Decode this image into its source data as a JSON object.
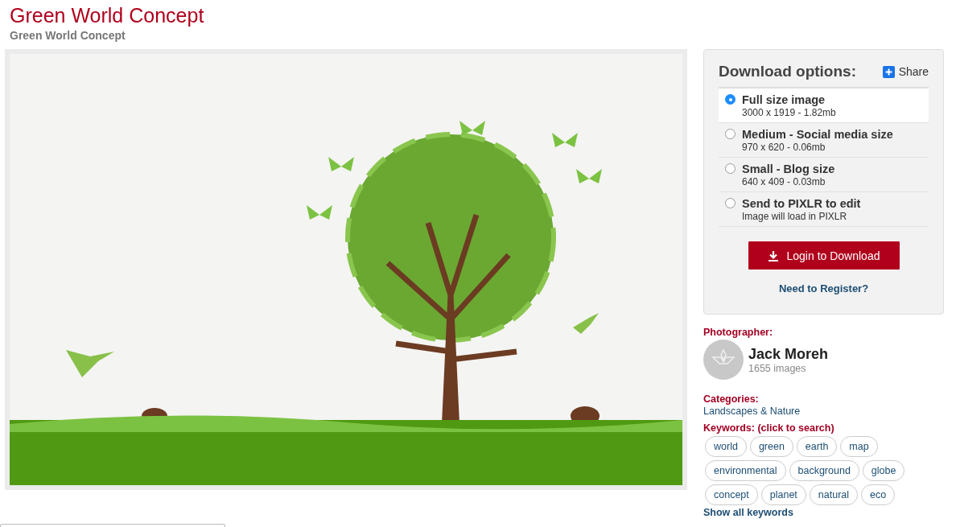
{
  "title": "Green World Concept",
  "subtitle": "Green World Concept",
  "download": {
    "heading": "Download options:",
    "share": "Share",
    "options": [
      {
        "label": "Full size image",
        "detail": "3000 x 1919 - 1.82mb",
        "selected": true
      },
      {
        "label": "Medium - Social media size",
        "detail": "970 x 620 - 0.06mb",
        "selected": false
      },
      {
        "label": "Small - Blog size",
        "detail": "640 x 409 - 0.03mb",
        "selected": false
      },
      {
        "label": "Send to PIXLR to edit",
        "detail": "Image will load in PIXLR",
        "selected": false
      }
    ],
    "button": "Login to Download",
    "register": "Need to Register?"
  },
  "photographer": {
    "heading": "Photographer:",
    "name": "Jack Moreh",
    "count": "1655 images"
  },
  "categories": {
    "heading": "Categories:",
    "items": [
      "Landscapes & Nature"
    ]
  },
  "keywords": {
    "heading": "Keywords: (click to search)",
    "items": [
      "world",
      "green",
      "earth",
      "map",
      "environmental",
      "background",
      "globe",
      "concept",
      "planet",
      "natural",
      "eco"
    ],
    "more": "Show all keywords"
  }
}
